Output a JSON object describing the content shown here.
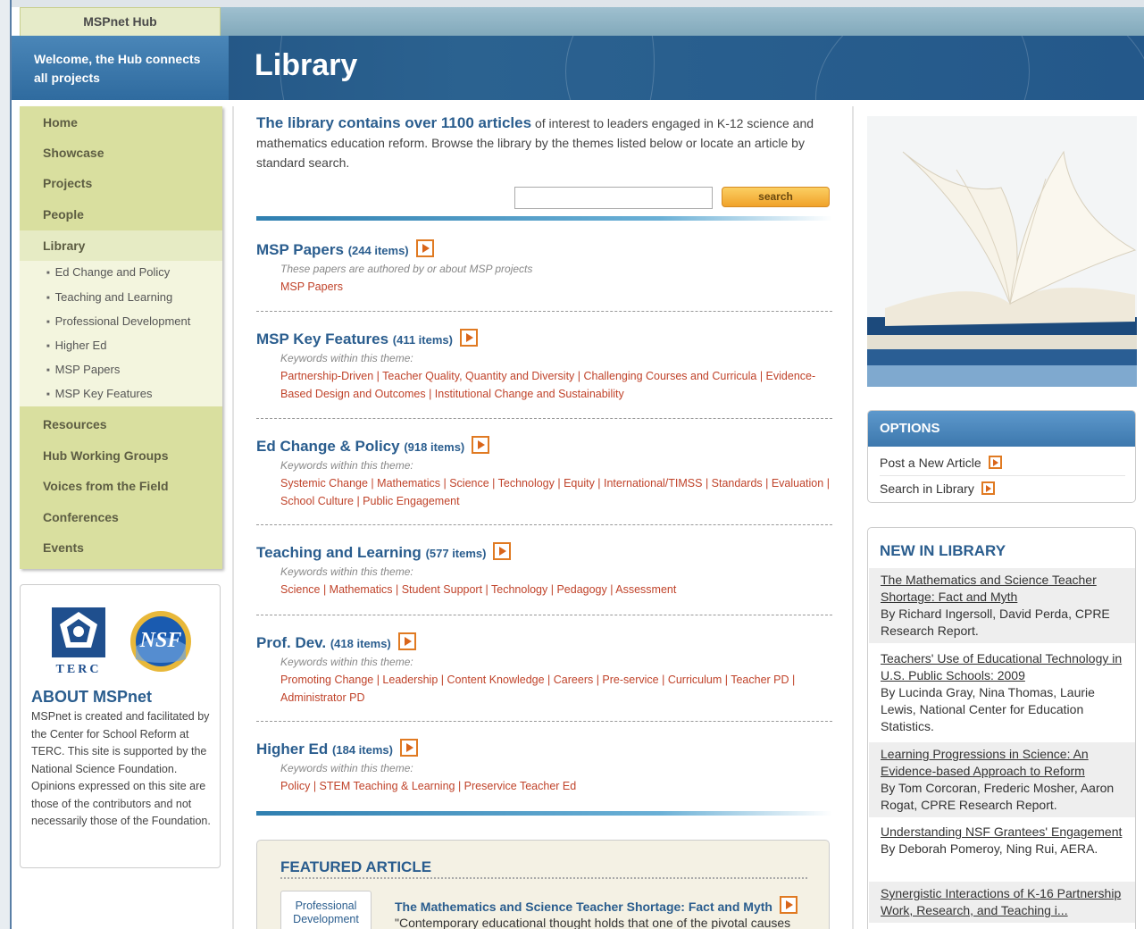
{
  "hub_tab": "MSPnet Hub",
  "banner": {
    "welcome": "Welcome, the Hub connects all projects",
    "title": "Library"
  },
  "nav": {
    "items": [
      "Home",
      "Showcase",
      "Projects",
      "People",
      "Library"
    ],
    "library_sub": [
      "Ed Change and Policy",
      "Teaching and Learning",
      "Professional Development",
      "Higher Ed",
      "MSP Papers",
      "MSP Key Features"
    ],
    "items2": [
      "Resources",
      "Hub Working Groups",
      "Voices from the Field",
      "Conferences",
      "Events"
    ]
  },
  "about": {
    "terc_label": "TERC",
    "nsf_label": "NSF",
    "title": "ABOUT MSPnet",
    "text": "MSPnet is created and facilitated by the Center for School Reform at TERC. This site is supported by the National Science Foundation. Opinions expressed on this site are those of the contributors and not necessarily those of the Foundation."
  },
  "intro": {
    "lead": "The library contains over 1100 articles",
    "rest": "of interest to leaders engaged in K-12 science and mathematics education reform. Browse the library by the themes listed below or locate an article by standard search."
  },
  "search": {
    "button": "search",
    "placeholder": ""
  },
  "sections": [
    {
      "title": "MSP Papers",
      "count": "(244 items)",
      "desc": "These papers are authored by or about MSP projects",
      "links": "MSP Papers"
    },
    {
      "title": "MSP Key Features",
      "count": "(411 items)",
      "desc": "Keywords within this theme:",
      "links": "Partnership-Driven | Teacher Quality, Quantity and Diversity | Challenging Courses and Curricula | Evidence-Based Design and Outcomes | Institutional Change and Sustainability"
    },
    {
      "title": "Ed Change & Policy",
      "count": "(918 items)",
      "desc": "Keywords within this theme:",
      "links": "Systemic Change | Mathematics | Science | Technology | Equity | International/TIMSS | Standards | Evaluation | School Culture | Public Engagement"
    },
    {
      "title": "Teaching and Learning",
      "count": "(577 items)",
      "desc": "Keywords within this theme:",
      "links": "Science | Mathematics | Student Support | Technology | Pedagogy | Assessment"
    },
    {
      "title": "Prof. Dev.",
      "count": "(418 items)",
      "desc": "Keywords within this theme:",
      "links": "Promoting Change | Leadership | Content Knowledge | Careers | Pre-service | Curriculum | Teacher PD | Administrator PD"
    },
    {
      "title": "Higher Ed",
      "count": "(184 items)",
      "desc": "Keywords within this theme:",
      "links": "Policy | STEM Teaching & Learning | Preservice Teacher Ed"
    }
  ],
  "featured": {
    "title": "FEATURED ARTICLE",
    "tag": "Professional Development",
    "headline": "The Mathematics and Science Teacher Shortage: Fact and Myth",
    "excerpt": "\"Contemporary educational thought holds that one of the pivotal causes"
  },
  "options": {
    "title": "OPTIONS",
    "items": [
      "Post a New Article",
      "Search in Library"
    ]
  },
  "new_in_library": {
    "title": "NEW IN LIBRARY",
    "items": [
      {
        "link": "The Mathematics and Science Teacher Shortage: Fact and Myth",
        "by": "By Richard Ingersoll, David Perda, CPRE Research Report."
      },
      {
        "link": "Teachers' Use of Educational Technology in U.S. Public Schools: 2009",
        "by": "By Lucinda Gray, Nina Thomas, Laurie Lewis, National Center for Education Statistics."
      },
      {
        "link": "Learning Progressions in Science: An Evidence-based Approach to Reform",
        "by": "By Tom Corcoran, Frederic Mosher, Aaron Rogat, CPRE Research Report."
      },
      {
        "link": "Understanding NSF Grantees' Engagement",
        "by": "By Deborah Pomeroy, Ning Rui, AERA."
      },
      {
        "link": "Synergistic Interactions of K-16 Partnership Work, Research, and Teaching i...",
        "by": ""
      }
    ]
  }
}
